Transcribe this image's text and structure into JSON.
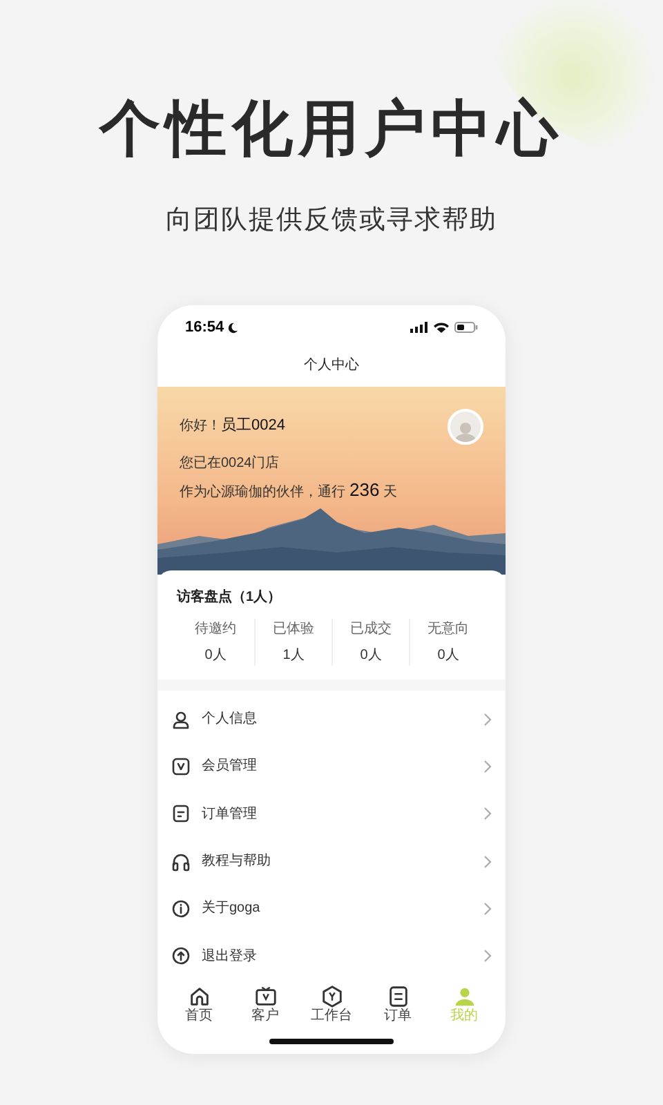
{
  "headline": "个性化用户中心",
  "subtitle": "向团队提供反馈或寻求帮助",
  "status_bar": {
    "time": "16:54"
  },
  "nav_title": "个人中心",
  "hero": {
    "greeting": "你好！",
    "name": "员工0024",
    "store": "您已在0024门店",
    "partner_text": "作为心源瑜伽的伙伴，通行",
    "days": "236",
    "days_unit": "天"
  },
  "visitor_card": {
    "title": "访客盘点（1人）",
    "stats": [
      {
        "label": "待邀约",
        "value": "0人"
      },
      {
        "label": "已体验",
        "value": "1人"
      },
      {
        "label": "已成交",
        "value": "0人"
      },
      {
        "label": "无意向",
        "value": "0人"
      }
    ]
  },
  "menu": [
    {
      "kind": "person",
      "label": "个人信息"
    },
    {
      "kind": "member",
      "label": "会员管理"
    },
    {
      "kind": "order",
      "label": "订单管理"
    },
    {
      "kind": "help",
      "label": "教程与帮助"
    },
    {
      "kind": "info",
      "label": "关于goga"
    },
    {
      "kind": "logout",
      "label": "退出登录"
    }
  ],
  "tabs": [
    {
      "kind": "home",
      "label": "首页",
      "selected": false
    },
    {
      "kind": "customer",
      "label": "客户",
      "selected": false
    },
    {
      "kind": "workbench",
      "label": "工作台",
      "selected": false
    },
    {
      "kind": "order",
      "label": "订单",
      "selected": false
    },
    {
      "kind": "me",
      "label": "我的",
      "selected": true
    }
  ]
}
